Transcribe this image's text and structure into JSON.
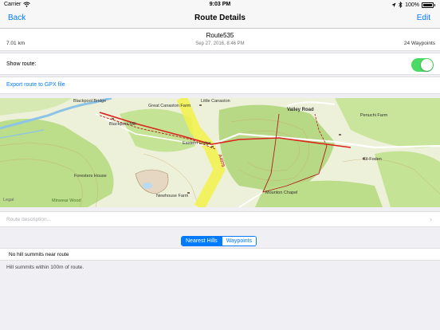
{
  "status_bar": {
    "carrier": "Carrier",
    "time": "9:03 PM",
    "battery_percent": "100%",
    "icons": [
      "wifi-icon",
      "location-arrow-icon",
      "bluetooth-icon",
      "battery-icon"
    ]
  },
  "nav": {
    "back_label": "Back",
    "title": "Route Details",
    "edit_label": "Edit"
  },
  "route": {
    "name": "Route535",
    "date": "Sep 27, 2016, 8:46 PM",
    "distance": "7.01 km",
    "waypoints": "24 Waypoints"
  },
  "show_route": {
    "label": "Show route:",
    "enabled": true
  },
  "export": {
    "label": "Export route to GPX file"
  },
  "map": {
    "labels": {
      "blackpool_bridge": "Blackpool Bridge",
      "little_canaston": "Little Canaston",
      "great_canaston_farm": "Great Canaston Farm",
      "valley_road": "Valley Road",
      "penuchi_farm": "Penuchi Farm",
      "blackpool_mill": "Blackpool Mill",
      "eastern_lodge": "Eastern Lodge",
      "cil_foden": "Cil-Foden",
      "foresters_house": "Foresters House",
      "newhouse_farm": "Newhouse Farm",
      "mounton_chapel": "Mounton Chapel",
      "minwear_wood": "Minwear Wood",
      "road_number": "A4075",
      "legal": "Legal"
    },
    "colors": {
      "background": "#eef1d9",
      "woodland": "#bcdd8a",
      "route": "#d9231c",
      "highlight": "#f2f24a",
      "river": "#8cc4e8"
    }
  },
  "description": {
    "placeholder": "Route description..."
  },
  "segments": {
    "items": [
      "Nearest Hills",
      "Waypoints"
    ],
    "selected": "Nearest Hills"
  },
  "hills": {
    "header": "No hill summits near route",
    "footer": "Hill summits within 100m of route."
  }
}
